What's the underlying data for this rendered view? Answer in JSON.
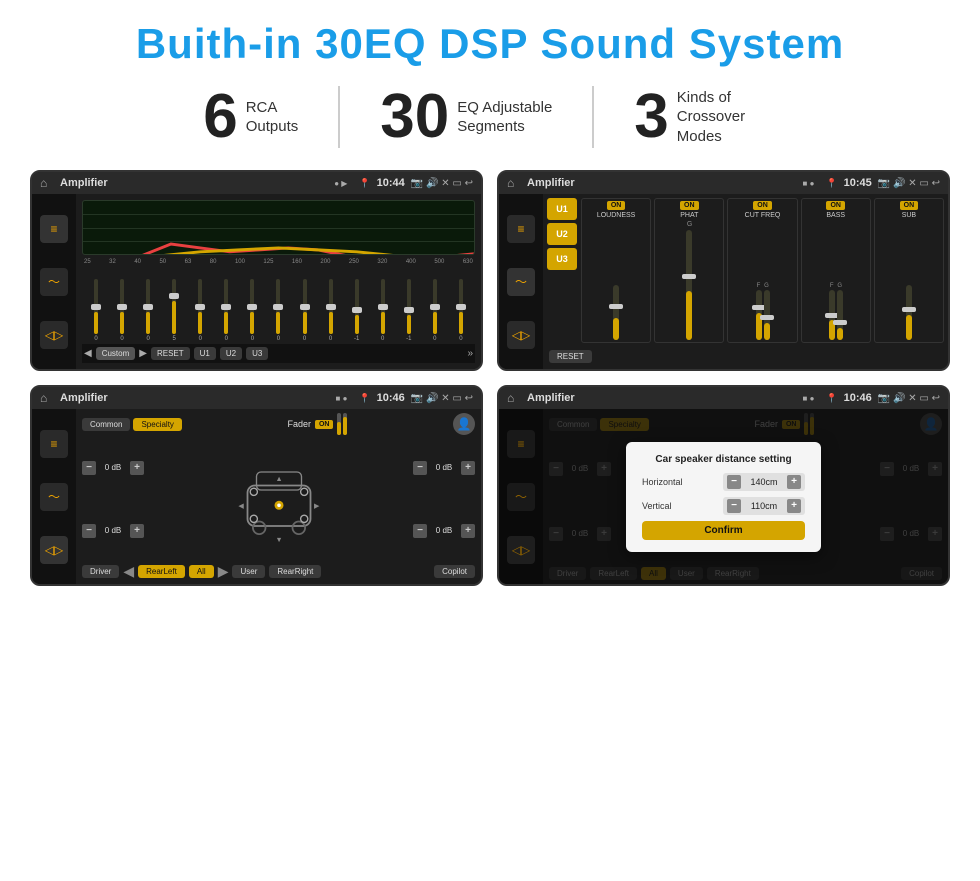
{
  "title": "Buith-in 30EQ DSP Sound System",
  "stats": [
    {
      "number": "6",
      "text_line1": "RCA",
      "text_line2": "Outputs"
    },
    {
      "number": "30",
      "text_line1": "EQ Adjustable",
      "text_line2": "Segments"
    },
    {
      "number": "3",
      "text_line1": "Kinds of",
      "text_line2": "Crossover Modes"
    }
  ],
  "screens": [
    {
      "id": "eq-screen",
      "status_title": "Amplifier",
      "status_time": "10:44",
      "type": "eq"
    },
    {
      "id": "crossover-screen",
      "status_title": "Amplifier",
      "status_time": "10:45",
      "type": "crossover"
    },
    {
      "id": "speaker-screen",
      "status_title": "Amplifier",
      "status_time": "10:46",
      "type": "speaker"
    },
    {
      "id": "dialog-screen",
      "status_title": "Amplifier",
      "status_time": "10:46",
      "type": "dialog"
    }
  ],
  "eq": {
    "freq_labels": [
      "25",
      "32",
      "40",
      "50",
      "63",
      "80",
      "100",
      "125",
      "160",
      "200",
      "250",
      "320",
      "400",
      "500",
      "630"
    ],
    "values": [
      0,
      0,
      0,
      5,
      0,
      0,
      0,
      0,
      0,
      0,
      -1,
      0,
      -1
    ],
    "preset_label": "Custom",
    "buttons": [
      "RESET",
      "U1",
      "U2",
      "U3"
    ]
  },
  "crossover": {
    "presets": [
      "U1",
      "U2",
      "U3"
    ],
    "controls": [
      {
        "label": "LOUDNESS",
        "on": true
      },
      {
        "label": "PHAT",
        "on": true
      },
      {
        "label": "CUT FREQ",
        "on": true
      },
      {
        "label": "BASS",
        "on": true
      },
      {
        "label": "SUB",
        "on": true
      }
    ],
    "reset_label": "RESET"
  },
  "speaker": {
    "modes": [
      "Common",
      "Specialty"
    ],
    "active_mode": "Specialty",
    "fader_label": "Fader",
    "fader_on": "ON",
    "db_values": [
      "0 dB",
      "0 dB",
      "0 dB",
      "0 dB"
    ],
    "bottom_buttons": [
      "Driver",
      "RearLeft",
      "All",
      "User",
      "RearRight",
      "Copilot"
    ]
  },
  "dialog": {
    "title": "Car speaker distance setting",
    "horizontal_label": "Horizontal",
    "horizontal_value": "140cm",
    "vertical_label": "Vertical",
    "vertical_value": "110cm",
    "confirm_label": "Confirm"
  },
  "colors": {
    "accent": "#d4a500",
    "blue_title": "#1a9de8",
    "bg_dark": "#1c1c1c",
    "bg_darker": "#111111"
  }
}
